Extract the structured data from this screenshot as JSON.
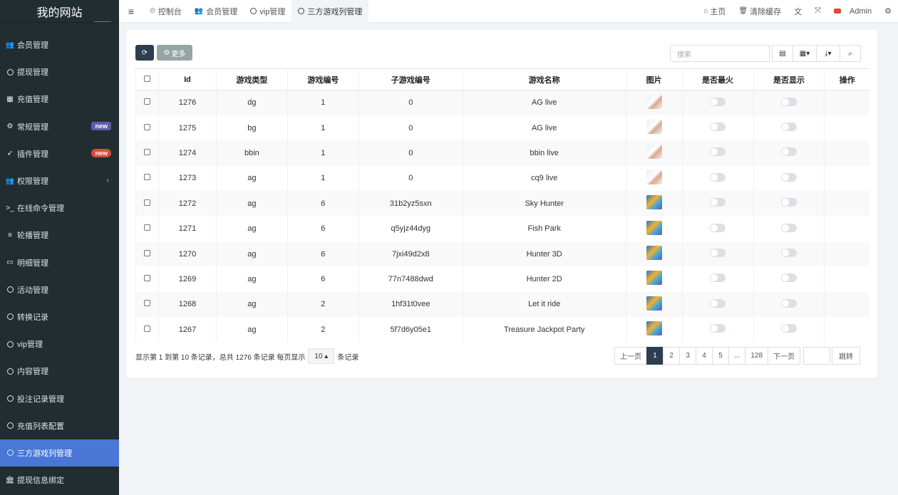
{
  "site": {
    "title": "我的网站"
  },
  "sidebar": {
    "items": [
      {
        "label": "会员管理",
        "icon": "users-icon",
        "glyph": "👥"
      },
      {
        "label": "提现管理",
        "icon": "circle-icon"
      },
      {
        "label": "充值管理",
        "icon": "grid-icon",
        "glyph": "▦"
      },
      {
        "label": "常规管理",
        "icon": "cogs-icon",
        "glyph": "⚙",
        "badge": "new"
      },
      {
        "label": "插件管理",
        "icon": "rocket-icon",
        "glyph": "➶",
        "badge": "new"
      },
      {
        "label": "权限管理",
        "icon": "users-icon",
        "glyph": "👥",
        "chevron": "‹"
      },
      {
        "label": "在线命令管理",
        "icon": "terminal-icon",
        "glyph": ">_"
      },
      {
        "label": "轮播管理",
        "icon": "bars-icon",
        "glyph": "≡"
      },
      {
        "label": "明细管理",
        "icon": "calendar-icon",
        "glyph": "▭"
      },
      {
        "label": "活动管理",
        "icon": "circle-icon"
      },
      {
        "label": "转换记录",
        "icon": "circle-icon"
      },
      {
        "label": "vip管理",
        "icon": "circle-icon"
      },
      {
        "label": "内容管理",
        "icon": "circle-icon"
      },
      {
        "label": "投注记录管理",
        "icon": "circle-icon"
      },
      {
        "label": "充值列表配置",
        "icon": "circle-icon"
      },
      {
        "label": "三方游戏列管理",
        "icon": "circle-icon",
        "active": true
      },
      {
        "label": "提现信息绑定",
        "icon": "bank-icon",
        "glyph": "🏛"
      }
    ]
  },
  "topbar": {
    "tabs": [
      {
        "label": "控制台",
        "glyph": "⏲"
      },
      {
        "label": "会员管理",
        "glyph": "👥"
      },
      {
        "label": "vip管理"
      },
      {
        "label": "三方游戏列管理",
        "active": true
      }
    ],
    "home_label": "主页",
    "clear_cache_label": "清除缓存",
    "user_label": "Admin"
  },
  "toolbar": {
    "more_label": "更多",
    "search_placeholder": "搜索"
  },
  "table": {
    "headers": [
      "Id",
      "游戏类型",
      "游戏编号",
      "子游戏编号",
      "游戏名称",
      "图片",
      "是否最火",
      "是否显示",
      "操作"
    ],
    "rows": [
      {
        "id": "1276",
        "type": "dg",
        "game_no": "1",
        "sub_no": "0",
        "name": "AG live",
        "img": "girl"
      },
      {
        "id": "1275",
        "type": "bg",
        "game_no": "1",
        "sub_no": "0",
        "name": "AG live",
        "img": "girl"
      },
      {
        "id": "1274",
        "type": "bbin",
        "game_no": "1",
        "sub_no": "0",
        "name": "bbin live",
        "img": "girl"
      },
      {
        "id": "1273",
        "type": "ag",
        "game_no": "1",
        "sub_no": "0",
        "name": "cq9 live",
        "img": "girl"
      },
      {
        "id": "1272",
        "type": "ag",
        "game_no": "6",
        "sub_no": "31b2yz5sxn",
        "name": "Sky Hunter",
        "img": "game"
      },
      {
        "id": "1271",
        "type": "ag",
        "game_no": "6",
        "sub_no": "q5yjz44dyg",
        "name": "Fish Park",
        "img": "game"
      },
      {
        "id": "1270",
        "type": "ag",
        "game_no": "6",
        "sub_no": "7jxi49d2x8",
        "name": "Hunter 3D",
        "img": "game"
      },
      {
        "id": "1269",
        "type": "ag",
        "game_no": "6",
        "sub_no": "77n7488dwd",
        "name": "Hunter 2D",
        "img": "game"
      },
      {
        "id": "1268",
        "type": "ag",
        "game_no": "2",
        "sub_no": "1hf31t0vee",
        "name": "Let it ride",
        "img": "game"
      },
      {
        "id": "1267",
        "type": "ag",
        "game_no": "2",
        "sub_no": "5f7d6y05e1",
        "name": "Treasure Jackpot Party",
        "img": "game"
      }
    ]
  },
  "footer": {
    "summary": "显示第 1 到第 10 条记录，总共 1276 条记录 每页显示",
    "page_size": "10",
    "suffix": "条记录",
    "prev": "上一页",
    "pages": [
      "1",
      "2",
      "3",
      "4",
      "5",
      "...",
      "128"
    ],
    "next": "下一页",
    "jump": "跳转"
  }
}
